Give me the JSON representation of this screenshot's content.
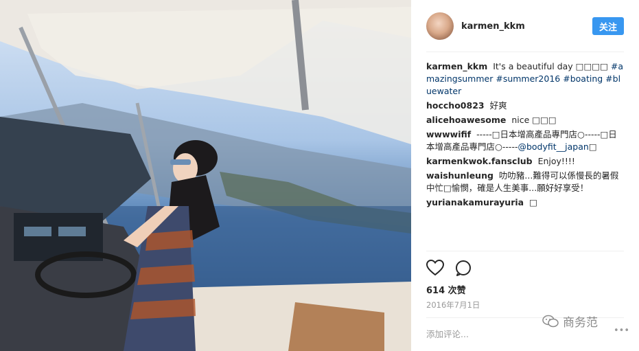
{
  "post": {
    "username": "karmen_kkm",
    "follow_label": "关注",
    "caption": {
      "user": "karmen_kkm",
      "text": "It's a beautiful day □□□□",
      "tags": [
        "#amazingsummer",
        "#summer2016",
        "#boating",
        "#bluewater"
      ]
    },
    "comments": [
      {
        "user": "hoccho0823",
        "text": "好爽"
      },
      {
        "user": "alicehoawesome",
        "text": "nice □□□"
      },
      {
        "user": "wwwwifif",
        "text": "-----□日本增高產品專門店○-----□日本增高產品專門店○-----",
        "mention": "@bodyfit__japan",
        "tail": "□"
      },
      {
        "user": "karmenkwok.fansclub",
        "text": "Enjoy!!!!"
      },
      {
        "user": "waishunleung",
        "text": "叻叻豬...難得可以係慢長的暑假中忙□愉憫，確是人生美事...願好好享受！"
      },
      {
        "user": "yurianakamurayuria",
        "text": "□"
      }
    ],
    "likes": "614 次赞",
    "date": "2016年7月1日",
    "add_comment_placeholder": "添加评论...",
    "more_label": "•••",
    "watermark": "商务范"
  },
  "icons": {
    "like": "heart-icon",
    "comment": "comment-icon",
    "watermark": "wechat-icon"
  },
  "colors": {
    "follow": "#3897f0",
    "link": "#003569",
    "text": "#262626",
    "muted": "#999999"
  }
}
